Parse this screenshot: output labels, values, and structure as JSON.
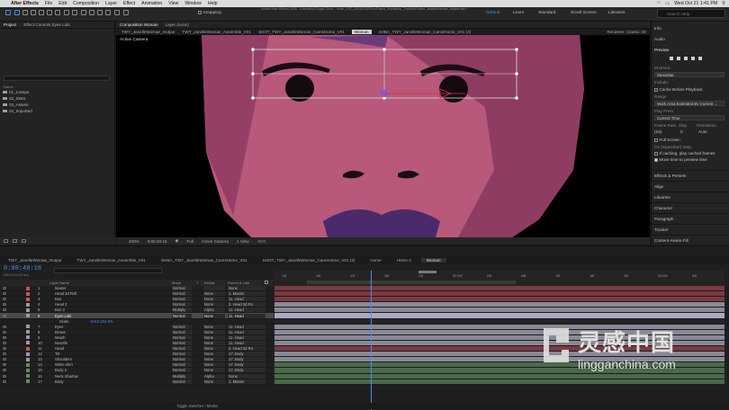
{
  "menubar": {
    "apple": "",
    "app": "After Effects",
    "items": [
      "File",
      "Edit",
      "Composition",
      "Layer",
      "Effect",
      "Animation",
      "View",
      "Window",
      "Help"
    ],
    "clock": "Wed Oct 21 1:41 PM"
  },
  "toolbar": {
    "title": "Adobe After Effects 2020 - /Users/ks/Google Drive .../mae_VSG_2019/03b/FloorFrame_Workshop_TheNewFolder_JanelleWomae_Master.aep *",
    "snapping": "Snapping",
    "workspaces": [
      "Default",
      "Learn",
      "Standard",
      "Small Screen",
      "Libraries"
    ],
    "active_workspace": "Default",
    "search_placeholder": "Search Help"
  },
  "project": {
    "tabs": [
      "Project",
      "Effect Controls Eyes Lids"
    ],
    "header_name": "Name",
    "folders": [
      "01_Comps",
      "02_Stars",
      "03_Assets",
      "04_Imported"
    ]
  },
  "viewer": {
    "tab": "Composition Woman",
    "layer_tab": "Layer (none)",
    "breadcrumbs": [
      "TWY_JanelleWomae_Output",
      "TWY_JanelleWomae_Assemble_V01",
      "SHOT_TWY_JanelleWomae_CamsHome_V01",
      "Woman",
      "SHBA_TWY_JanelleWomae_CamsHome_V01 (2)"
    ],
    "renderer": "Renderer:",
    "renderer_value": "Classic 3D",
    "active_camera": "Active Camera",
    "footer": {
      "zoom": "400%",
      "timecode": "0:00:40:18",
      "resolution": "Full",
      "camera": "Active Camera",
      "views": "1 View",
      "offset": "+0.0"
    }
  },
  "right_panel": {
    "info": "Info",
    "audio": "Audio",
    "preview": "Preview",
    "shortcut_label": "Shortcut",
    "shortcut_value": "Spacebar",
    "include": "Include:",
    "cache": "Cache Before Playback",
    "range": "Range",
    "range_value": "Work Area Extended By Current ...",
    "play_from": "Play From",
    "play_from_value": "Current Time",
    "frame_rate": "Frame Rate",
    "skip": "Skip",
    "resolution": "Resolution",
    "fr_value": "(24)",
    "skip_value": "0",
    "res_value": "Auto",
    "full_screen": "Full Screen",
    "on_stop": "On (Spacebar) Stop:",
    "if_caching": "If caching, play cached frames",
    "move_time": "Move time to preview time",
    "sections": [
      "Effects & Presets",
      "Align",
      "Libraries",
      "Character",
      "Paragraph",
      "Tracker",
      "Content-Aware Fill"
    ]
  },
  "timeline": {
    "tabs": [
      "TWY_JanelleWomae_Output",
      "TWY_JanelleWomae_Assemble_V01",
      "SHBA_TWY_JanelleWomae_CamsHome_V01",
      "SHOT_TWY_JanelleWomae_CamsHome_V01 (2)",
      "Home",
      "Home 2",
      "Woman"
    ],
    "active_tab": "Woman",
    "timecode": "0:00:40:18",
    "fps": "00978 (24.00 fps)",
    "header": {
      "name": "Layer Name",
      "mode": "Mode",
      "t": "T",
      "trkmat": "TrkMat",
      "parent": "Parent & Link"
    },
    "ruler": [
      "14f",
      "16f",
      "12f",
      "16f",
      "20f",
      "02:00f",
      "04f",
      "08f",
      "12f",
      "16f",
      "20f",
      "02:00f",
      "04f"
    ],
    "layers": [
      {
        "n": "1",
        "name": "Master",
        "mode": "Normal",
        "mat": "",
        "parent": "None",
        "label": "#c95555"
      },
      {
        "n": "2",
        "name": "Head 3d Roll",
        "mode": "Normal",
        "mat": "None",
        "parent": "1. Master",
        "label": "#c95555"
      },
      {
        "n": "3",
        "name": "Bus",
        "mode": "Normal",
        "mat": "None",
        "parent": "11. Head",
        "label": "#c95555"
      },
      {
        "n": "4",
        "name": "Head 2",
        "mode": "Normal",
        "mat": "None",
        "parent": "2. Head 3d Ro",
        "label": "#9a9aa8"
      },
      {
        "n": "5",
        "name": "Bun 2",
        "mode": "Multiply",
        "mat": "Alpha",
        "parent": "11. Head",
        "label": "#9a9aa8"
      },
      {
        "n": "6",
        "name": "Eyes Lids",
        "mode": "Normal",
        "mat": "None",
        "parent": "11. Head",
        "label": "#9a9aa8",
        "selected": true
      },
      {
        "n": "",
        "name": "Scale",
        "mode": "104.0,104.0%",
        "mat": "",
        "parent": "",
        "label": "",
        "sub": true
      },
      {
        "n": "7",
        "name": "Eyes",
        "mode": "Normal",
        "mat": "None",
        "parent": "11. Head",
        "label": "#9a9aa8"
      },
      {
        "n": "8",
        "name": "Brows",
        "mode": "Normal",
        "mat": "None",
        "parent": "11. Head",
        "label": "#9a9aa8"
      },
      {
        "n": "9",
        "name": "Mouth",
        "mode": "Normal",
        "mat": "None",
        "parent": "11. Head",
        "label": "#9a9aa8"
      },
      {
        "n": "10",
        "name": "Nostrils",
        "mode": "Normal",
        "mat": "None",
        "parent": "11. Head",
        "label": "#9a9aa8"
      },
      {
        "n": "11",
        "name": "Head",
        "mode": "Normal",
        "mat": "None",
        "parent": "2. Head 3d Ro",
        "label": "#c95555"
      },
      {
        "n": "12",
        "name": "Tilt",
        "mode": "Normal",
        "mat": "None",
        "parent": "17. Body",
        "label": "#9a9aa8"
      },
      {
        "n": "13",
        "name": "Shoulders",
        "mode": "Normal",
        "mat": "None",
        "parent": "17. Body",
        "label": "#9a9aa8"
      },
      {
        "n": "14",
        "name": "White shirt",
        "mode": "Normal",
        "mat": "None",
        "parent": "17. Body",
        "label": "#5f8f5f"
      },
      {
        "n": "15",
        "name": "Body 2",
        "mode": "Normal",
        "mat": "None",
        "parent": "17. Body",
        "label": "#5f8f5f"
      },
      {
        "n": "16",
        "name": "Neck Shadow",
        "mode": "Multiply",
        "mat": "Alpha",
        "parent": "None",
        "label": "#5f8f5f"
      },
      {
        "n": "17",
        "name": "Body",
        "mode": "Normal",
        "mat": "None",
        "parent": "1. Master",
        "label": "#5f8f5f"
      }
    ],
    "track_colors": [
      "#7a3a42",
      "#7a3a42",
      "#7a3a42",
      "#8a8a96",
      "#8a8a96",
      "#a9a9c2",
      "#242424",
      "#8a8a96",
      "#8a8a96",
      "#8a8a96",
      "#8a8a96",
      "#7a3a42",
      "#8a8a96",
      "#8a8a96",
      "#4a6a4a",
      "#4a6a4a",
      "#4a6a4a",
      "#4a6a4a"
    ],
    "footer": "Toggle Switches / Modes"
  },
  "watermark": {
    "cn": "灵感中国",
    "url": "lingganchina.com"
  }
}
